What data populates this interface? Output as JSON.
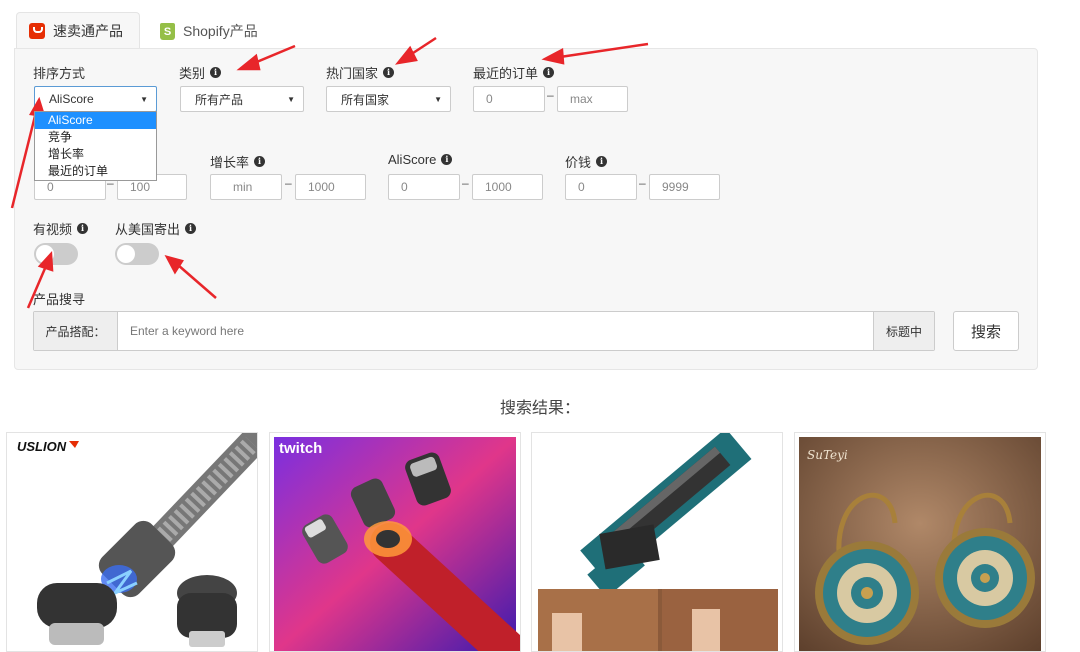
{
  "tabs": [
    {
      "label": "速卖通产品",
      "icon": "aliexpress-icon",
      "active": true
    },
    {
      "label": "Shopify产品",
      "icon": "shopify-icon",
      "active": false
    }
  ],
  "filters": {
    "sort_label": "排序方式",
    "sort_value": "AliScore",
    "sort_options": [
      "AliScore",
      "竞争",
      "增长率",
      "最近的订单"
    ],
    "category_label": "类别",
    "category_value": "所有产品",
    "country_label": "热门国家",
    "country_value": "所有国家",
    "orders_label": "最近的订单",
    "orders_min": "0",
    "orders_max": "max",
    "competition_min": "0",
    "competition_max": "100",
    "growth_label": "增长率",
    "growth_min": "min",
    "growth_max": "1000",
    "aliscore_label": "AliScore",
    "aliscore_min": "0",
    "aliscore_max": "1000",
    "price_label": "价钱",
    "price_min": "0",
    "price_max": "9999",
    "dash": "–",
    "has_video_label": "有视频",
    "ships_us_label": "从美国寄出"
  },
  "search": {
    "section_label": "产品搜寻",
    "prefix": "产品搭配：",
    "placeholder": "Enter a keyword here",
    "suffix": "标题中",
    "button": "搜索"
  },
  "results": {
    "title": "搜索结果：",
    "items": [
      {
        "brand": "USLION",
        "icon": "magnetic-cable-image"
      },
      {
        "brand": "twitch",
        "icon": "magnetic-plug-image"
      },
      {
        "brand": "",
        "icon": "contour-gauge-image"
      },
      {
        "brand": "SuTeyi",
        "icon": "mandala-earrings-image"
      }
    ]
  },
  "colors": {
    "accent_blue": "#1e90ff",
    "arrow_red": "#e8262a",
    "panel_bg": "#f7f7f7"
  }
}
